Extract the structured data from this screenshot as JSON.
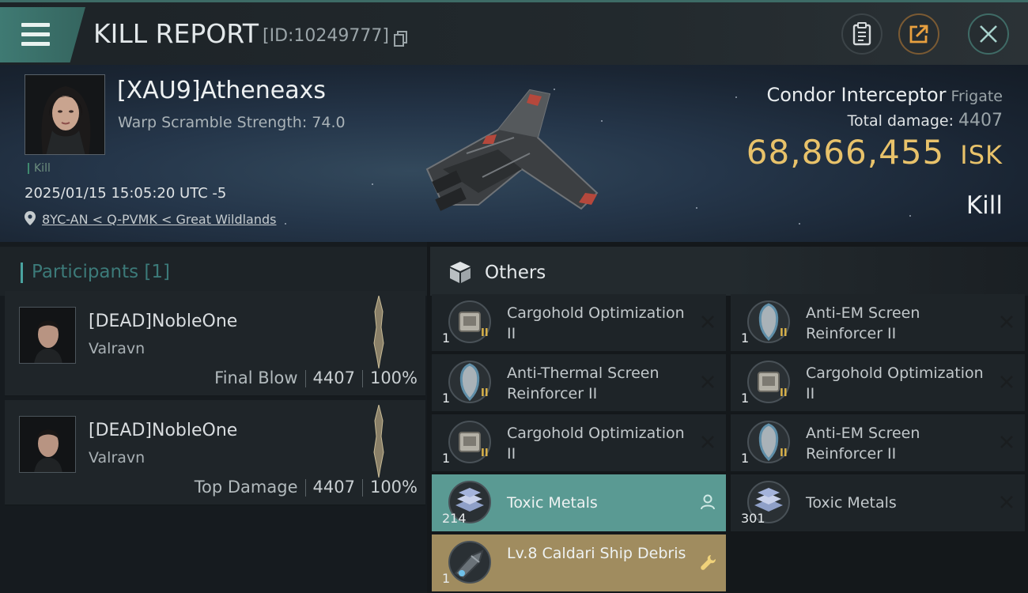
{
  "header": {
    "title": "KILL REPORT",
    "report_id": "[ID:10249777]",
    "buttons": [
      "clipboard-icon",
      "share-icon",
      "close-icon"
    ]
  },
  "victim": {
    "name": "[XAU9]Atheneaxs",
    "warp_scramble": "Warp Scramble Strength: 74.0",
    "kill_tag": "Kill",
    "datetime": "2025/01/15 15:05:20 UTC -5",
    "location": "8YC-AN < Q-PVMK < Great Wildlands",
    "ship_name": "Condor Interceptor",
    "ship_class": "Frigate",
    "total_damage_label": "Total damage:",
    "total_damage": "4407",
    "isk_value": "68,866,455",
    "isk_unit": "ISK",
    "result": "Kill"
  },
  "participants": {
    "title": "Participants [1]",
    "rows": [
      {
        "name": "[DEAD]NobleOne",
        "ship": "Valravn",
        "role": "Final Blow",
        "damage": "4407",
        "percent": "100%"
      },
      {
        "name": "[DEAD]NobleOne",
        "ship": "Valravn",
        "role": "Top Damage",
        "damage": "4407",
        "percent": "100%"
      }
    ]
  },
  "others": {
    "title": "Others",
    "items": [
      {
        "name": "Cargohold Optimization II",
        "qty": "1",
        "icon": "cargohold-module-icon",
        "status": "destroyed"
      },
      {
        "name": "Anti-EM Screen Reinforcer II",
        "qty": "1",
        "icon": "shield-reinforcer-icon",
        "status": "destroyed"
      },
      {
        "name": "Anti-Thermal Screen Reinforcer II",
        "qty": "1",
        "icon": "shield-reinforcer-icon",
        "status": "destroyed"
      },
      {
        "name": "Cargohold Optimization II",
        "qty": "1",
        "icon": "cargohold-module-icon",
        "status": "destroyed"
      },
      {
        "name": "Cargohold Optimization II",
        "qty": "1",
        "icon": "cargohold-module-icon",
        "status": "destroyed"
      },
      {
        "name": "Anti-EM Screen Reinforcer II",
        "qty": "1",
        "icon": "shield-reinforcer-icon",
        "status": "destroyed"
      },
      {
        "name": "Toxic Metals",
        "qty": "214",
        "icon": "ore-ingots-icon",
        "status": "dropped"
      },
      {
        "name": "Toxic Metals",
        "qty": "301",
        "icon": "ore-ingots-icon",
        "status": "destroyed"
      },
      {
        "name": "Lv.8 Caldari Ship Debris",
        "qty": "1",
        "icon": "ship-debris-icon",
        "status": "salvage"
      }
    ]
  },
  "colors": {
    "accent_teal": "#4aa3a0",
    "isk_gold": "#e8c26a",
    "dropped_green": "#5a9a93",
    "salvage_gold": "#a08c5f"
  }
}
